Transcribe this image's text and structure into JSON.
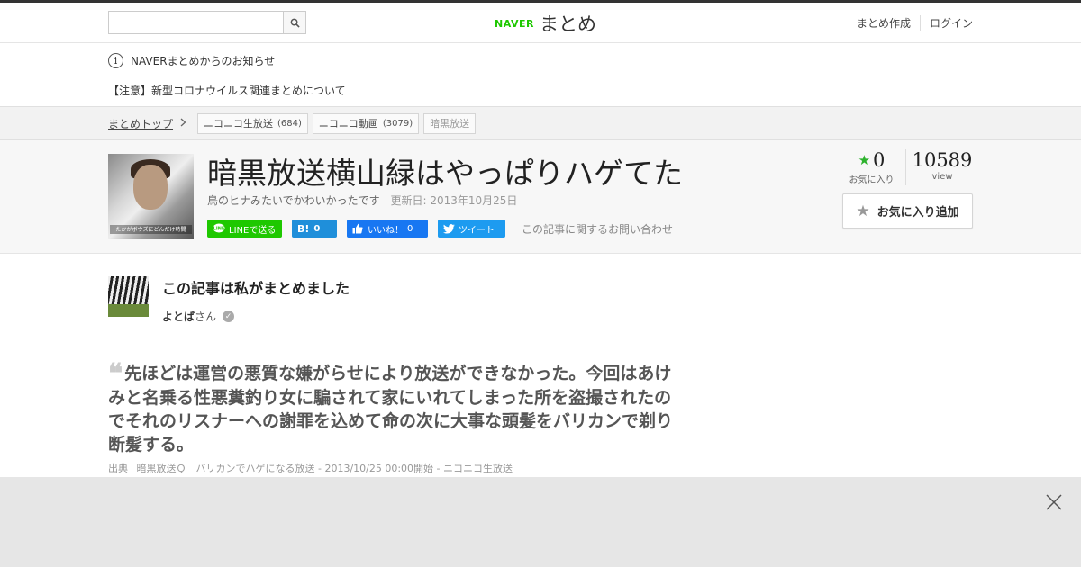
{
  "header": {
    "search_placeholder": "",
    "logo_brand": "NAVER",
    "logo_text": "まとめ",
    "links": [
      "まとめ作成",
      "ログイン"
    ]
  },
  "notice": {
    "icon_text": "i",
    "title": "NAVERまとめからのお知らせ",
    "link": "【注意】新型コロナウイルス関連まとめについて"
  },
  "breadcrumb": {
    "top": "まとめトップ",
    "tags": [
      {
        "label": "ニコニコ生放送",
        "count": "(684)"
      },
      {
        "label": "ニコニコ動画",
        "count": "(3079)"
      },
      {
        "label": "暗黒放送",
        "count": ""
      }
    ]
  },
  "article": {
    "title": "暗黒放送横山緑はやっぱりハゲてた",
    "description": "鳥のヒナみたいでかわいかったです",
    "updated": "更新日: 2013年10月25日",
    "thumb_caption": "たかがボウズにどんだけ時間",
    "share": {
      "line": "LINEで送る",
      "hatena_icon": "B!",
      "hatena_count": "0",
      "fb_label": "いいね！",
      "fb_count": "0",
      "tweet": "ツイート"
    },
    "inquiry": "この記事に関するお問い合わせ",
    "fav_count": "0",
    "fav_label": "お気に入り",
    "views": "10589",
    "views_label": "view",
    "fav_add": "お気に入り追加"
  },
  "author": {
    "heading": "この記事は私がまとめました",
    "name": "よとば",
    "suffix": "さん"
  },
  "quote": {
    "mark": "❝",
    "text": "先ほどは運営の悪質な嫌がらせにより放送ができなかった。今回はあけみと名乗る性悪糞釣り女に騙されて家にいれてしまった所を盗撮されたのでそれのリスナーへの謝罪を込めて命の次に大事な頭髪をバリカンで剃り断髪する。",
    "source_label": "出典",
    "source_text": "暗黒放送Ｑ　バリカンでハゲになる放送 - 2013/10/25 00:00開始 - ニコニコ生放送"
  },
  "colors": {
    "naver_green": "#1ec800",
    "star_green": "#2db22d",
    "hatena_blue": "#1f8fda",
    "facebook_blue": "#1877f2",
    "twitter_blue": "#1d9bf0"
  }
}
